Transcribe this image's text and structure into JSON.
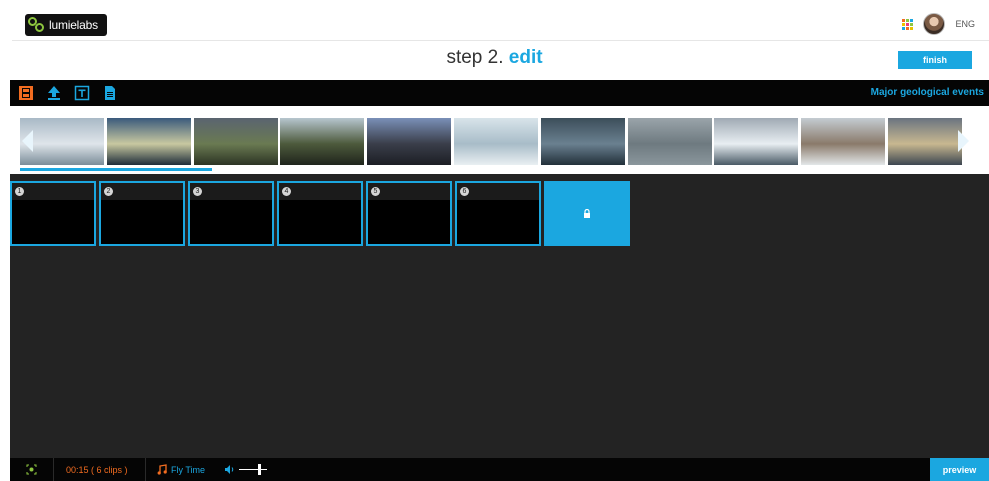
{
  "brand": {
    "name": "lumielabs"
  },
  "header": {
    "lang": "ENG",
    "apps_colors": [
      "#f26c20",
      "#8ec63f",
      "#1ba7e0",
      "#e8c200",
      "#ec3a7c",
      "#8ec63f",
      "#1ba7e0",
      "#f26c20",
      "#e8c200"
    ]
  },
  "page": {
    "step_label": "step 2.",
    "step_name": "edit"
  },
  "actions": {
    "finish_label": "finish",
    "preview_label": "preview"
  },
  "toolbar": {
    "tools": [
      {
        "icon": "film-icon",
        "color": "#f26c20"
      },
      {
        "icon": "upload-icon",
        "color": "#1ba7e0"
      },
      {
        "icon": "text-icon",
        "color": "#1ba7e0"
      },
      {
        "icon": "document-icon",
        "color": "#1ba7e0"
      }
    ],
    "project_title": "Major geological events"
  },
  "clips_strip": {
    "thumbnails": [
      {
        "colors": [
          "#a9b9c6",
          "#dfe5ea",
          "#7b8d99"
        ]
      },
      {
        "colors": [
          "#3a5a7c",
          "#c8c8a0",
          "#1e2c3a"
        ]
      },
      {
        "colors": [
          "#5a6470",
          "#6a7a52",
          "#2c3424"
        ]
      },
      {
        "colors": [
          "#b7c6cf",
          "#4d5a3c",
          "#1f241c"
        ]
      },
      {
        "colors": [
          "#7a90b8",
          "#3a3e4a",
          "#1c1e24"
        ]
      },
      {
        "colors": [
          "#d8e4ea",
          "#a8bcc8",
          "#e9eff2"
        ]
      },
      {
        "colors": [
          "#3c4e5a",
          "#6a8090",
          "#22303a"
        ]
      },
      {
        "colors": [
          "#9aa4aa",
          "#6e7a80",
          "#8a969c"
        ]
      },
      {
        "colors": [
          "#a0aab4",
          "#e8eef2",
          "#4a5a66"
        ]
      },
      {
        "colors": [
          "#c4ccd2",
          "#8a7a6a",
          "#e2e6e8"
        ]
      },
      {
        "colors": [
          "#6a7480",
          "#c8b890",
          "#3c4650"
        ]
      }
    ]
  },
  "timeline": {
    "slots": [
      {
        "number": "1"
      },
      {
        "number": "2"
      },
      {
        "number": "3"
      },
      {
        "number": "4"
      },
      {
        "number": "5"
      },
      {
        "number": "6"
      }
    ],
    "locked_slot_icon": "lock-icon"
  },
  "footer": {
    "duration": "00:15",
    "clips": "( 6 clips )",
    "music_title": "Fly Time"
  },
  "colors": {
    "accent": "#1ba7e0",
    "orange": "#f26c20",
    "toolbar_bg": "#050505",
    "timeline_bg": "#232323"
  }
}
